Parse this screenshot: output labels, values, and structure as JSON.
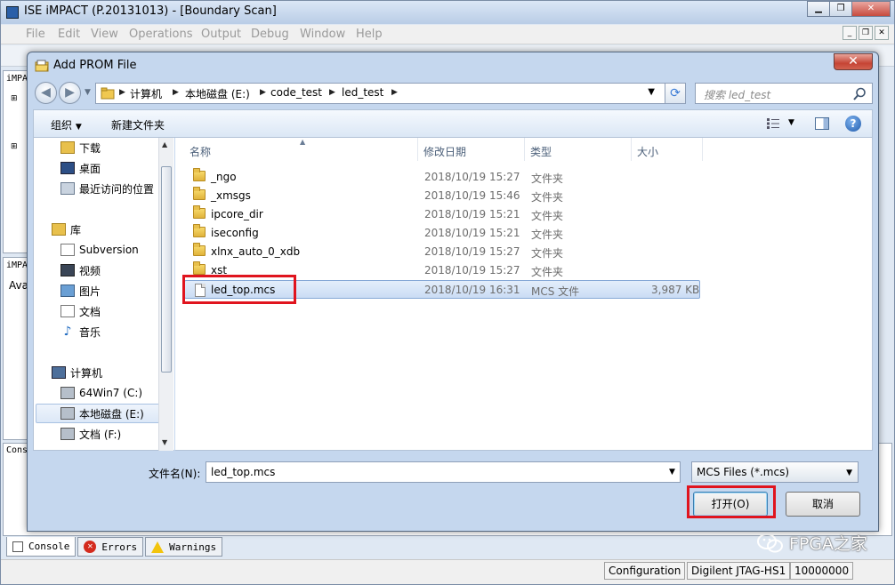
{
  "main": {
    "title": "ISE iMPACT (P.20131013) - [Boundary Scan]",
    "menu": [
      "File",
      "Edit",
      "View",
      "Operations",
      "Output",
      "Debug",
      "Window",
      "Help"
    ],
    "panel_tabs": [
      "iMPA",
      "iMPA",
      "Ava",
      "Cons"
    ],
    "console_tabs": [
      "Console",
      "Errors",
      "Warnings"
    ],
    "status": [
      "Configuration",
      "Digilent JTAG-HS1",
      "10000000"
    ],
    "watermark": "FPGA之家"
  },
  "dialog": {
    "title": "Add PROM File",
    "breadcrumbs": [
      "计算机",
      "本地磁盘 (E:)",
      "code_test",
      "led_test"
    ],
    "search_placeholder": "搜索 led_test",
    "commands": {
      "organize": "组织",
      "new_folder": "新建文件夹"
    },
    "nav": [
      {
        "label": "下载",
        "icon": "download-folder-icon"
      },
      {
        "label": "桌面",
        "icon": "desktop-icon"
      },
      {
        "label": "最近访问的位置",
        "icon": "recent-places-icon"
      },
      {
        "label": "库",
        "icon": "library-icon"
      },
      {
        "label": "Subversion",
        "icon": "document-icon"
      },
      {
        "label": "视频",
        "icon": "video-icon"
      },
      {
        "label": "图片",
        "icon": "pictures-icon"
      },
      {
        "label": "文档",
        "icon": "document-icon"
      },
      {
        "label": "音乐",
        "icon": "music-icon"
      },
      {
        "label": "计算机",
        "icon": "computer-icon"
      },
      {
        "label": "64Win7  (C:)",
        "icon": "drive-icon"
      },
      {
        "label": "本地磁盘 (E:)",
        "icon": "drive-icon"
      },
      {
        "label": "文档 (F:)",
        "icon": "drive-icon"
      }
    ],
    "columns": [
      "名称",
      "修改日期",
      "类型",
      "大小"
    ],
    "files": [
      {
        "name": "_ngo",
        "date": "2018/10/19 15:27",
        "type": "文件夹",
        "size": ""
      },
      {
        "name": "_xmsgs",
        "date": "2018/10/19 15:46",
        "type": "文件夹",
        "size": ""
      },
      {
        "name": "ipcore_dir",
        "date": "2018/10/19 15:21",
        "type": "文件夹",
        "size": ""
      },
      {
        "name": "iseconfig",
        "date": "2018/10/19 15:21",
        "type": "文件夹",
        "size": ""
      },
      {
        "name": "xlnx_auto_0_xdb",
        "date": "2018/10/19 15:27",
        "type": "文件夹",
        "size": ""
      },
      {
        "name": "xst",
        "date": "2018/10/19 15:27",
        "type": "文件夹",
        "size": ""
      },
      {
        "name": "led_top.mcs",
        "date": "2018/10/19 16:31",
        "type": "MCS 文件",
        "size": "3,987 KB"
      }
    ],
    "filename_label": "文件名(N):",
    "filename_value": "led_top.mcs",
    "filetype": "MCS Files (*.mcs)",
    "open_label": "打开(O)",
    "cancel_label": "取消"
  },
  "colors": {
    "highlight": "#e0141e",
    "selection": "#cadcf4",
    "dialog_frame": "#c5d7ee"
  }
}
